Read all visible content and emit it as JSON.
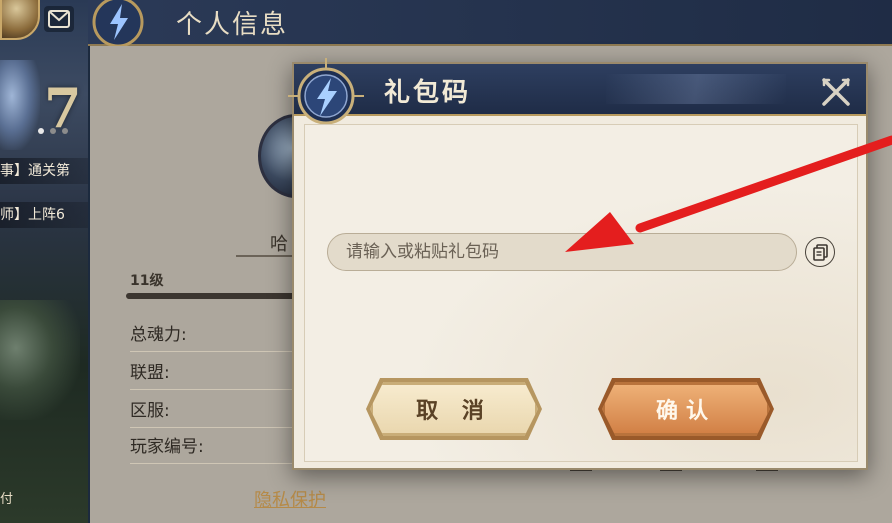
{
  "background": {
    "level_number": "7",
    "task_lines": [
      "事】通关第",
      "师】上阵6"
    ],
    "bottom_left_text": "付"
  },
  "profile": {
    "title": "个人信息",
    "name": "哈",
    "level": "11级",
    "level_progress": 0.9,
    "fields": [
      "总魂力:",
      "联盟:",
      "区服:",
      "玩家编号:"
    ],
    "privacy_link": "隐私保护"
  },
  "dialog": {
    "title": "礼包码",
    "input_placeholder": "请输入或粘贴礼包码",
    "input_value": "",
    "cancel_label": "取 消",
    "confirm_label": "确认"
  },
  "icons": {
    "close": "close-x-icon",
    "paste": "paste-icon",
    "emblem": "lightning-emblem-icon",
    "mail": "mail-icon"
  },
  "colors": {
    "header_bg": "#1f2c47",
    "panel_bg": "#f1ebdf",
    "confirm_button": "#d07e43",
    "cancel_button": "#e9d6ad",
    "annotation_arrow": "#e41e1e"
  }
}
